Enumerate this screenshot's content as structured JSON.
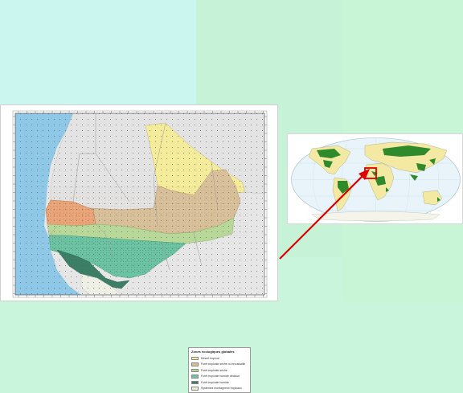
{
  "slide": {
    "background": "#c9f5dc"
  },
  "map": {
    "legend": {
      "title": "Zones écologiques globales",
      "items": [
        {
          "label": "Désert tropical",
          "color": "#f4ec9b"
        },
        {
          "label": "Forêt tropicale sèche ou broussaille",
          "color": "#d7c09a"
        },
        {
          "label": "Forêt tropicale sèche",
          "color": "#b8d89a"
        },
        {
          "label": "Forêt tropicale humide décidue",
          "color": "#6cc4a4"
        },
        {
          "label": "Forêt tropicale humide",
          "color": "#3b7f66"
        },
        {
          "label": "Systèmes montagneux tropicaux",
          "color": "#e9f1c6"
        }
      ]
    },
    "zone_colors": {
      "ocean": "#8fc8e6",
      "land": "#e6e6e6",
      "desert": "#f4ec9b",
      "shrub": "#d7c09a",
      "dry_forest": "#b8d89a",
      "moist_forest": "#6cc4a4",
      "rainforest": "#3b7f66",
      "orange_zone": "#e9a679"
    }
  },
  "world_map": {
    "ocean_color": "#e8f4fa",
    "land_color": "#f4e9a3",
    "forest_color": "#2f8a2c",
    "highlight_color": "#e00000"
  },
  "arrow": {
    "color": "#e00000"
  }
}
